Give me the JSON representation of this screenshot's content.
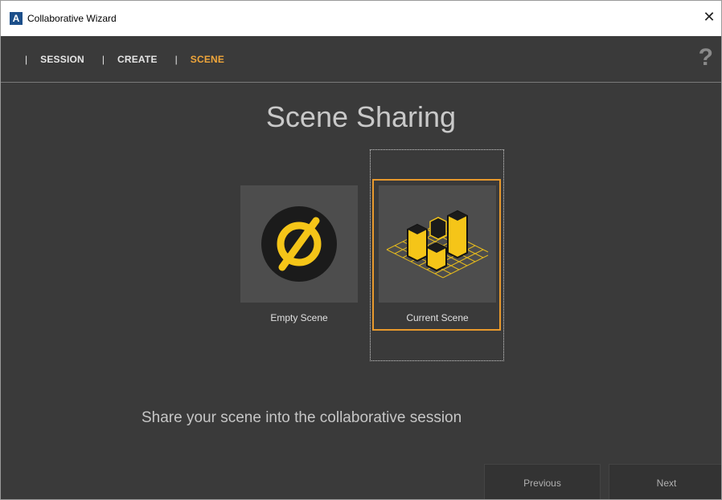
{
  "window": {
    "title": "Collaborative Wizard",
    "app_icon_letter": "A",
    "close_glyph": "✕"
  },
  "nav": {
    "separator": "|",
    "items": [
      {
        "label": "SESSION",
        "active": false
      },
      {
        "label": "CREATE",
        "active": false
      },
      {
        "label": "SCENE",
        "active": true
      }
    ],
    "help_glyph": "?"
  },
  "main": {
    "title": "Scene Sharing",
    "options": [
      {
        "label": "Empty Scene",
        "icon": "empty-set-icon",
        "selected": false
      },
      {
        "label": "Current Scene",
        "icon": "scene-blocks-icon",
        "selected": true
      }
    ],
    "description": "Share your scene into the collaborative session"
  },
  "footer": {
    "previous_label": "Previous",
    "next_label": "Next"
  },
  "colors": {
    "accent": "#f0a63a",
    "selection": "#e8992c",
    "icon_yellow": "#f5c518",
    "background": "#3a3a3a"
  }
}
